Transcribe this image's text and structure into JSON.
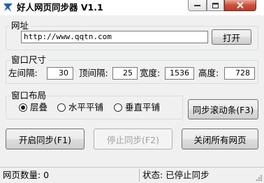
{
  "window": {
    "title": "好人网页同步器 V1.1"
  },
  "url_group": {
    "label": "网址",
    "url_value": "http://www.qqtn.com",
    "open_button": "打开"
  },
  "size_group": {
    "label": "窗口尺寸",
    "left_margin_label": "左间隔:",
    "left_margin_value": "30",
    "top_margin_label": "顶间隔:",
    "top_margin_value": "25",
    "width_label": "宽度:",
    "width_value": "1536",
    "height_label": "高度:",
    "height_value": "728"
  },
  "layout_group": {
    "label": "窗口布局",
    "options": [
      "层叠",
      "水平平铺",
      "垂直平铺"
    ],
    "selected": "层叠",
    "sync_scroll_button": "同步滚动条(F3)"
  },
  "actions": {
    "start_sync": "开启同步(F1)",
    "stop_sync": "停止同步(F2)",
    "close_all": "关闭所有网页"
  },
  "status": {
    "page_count": "网页数量: 0",
    "state": "状态: 已停止同步"
  }
}
